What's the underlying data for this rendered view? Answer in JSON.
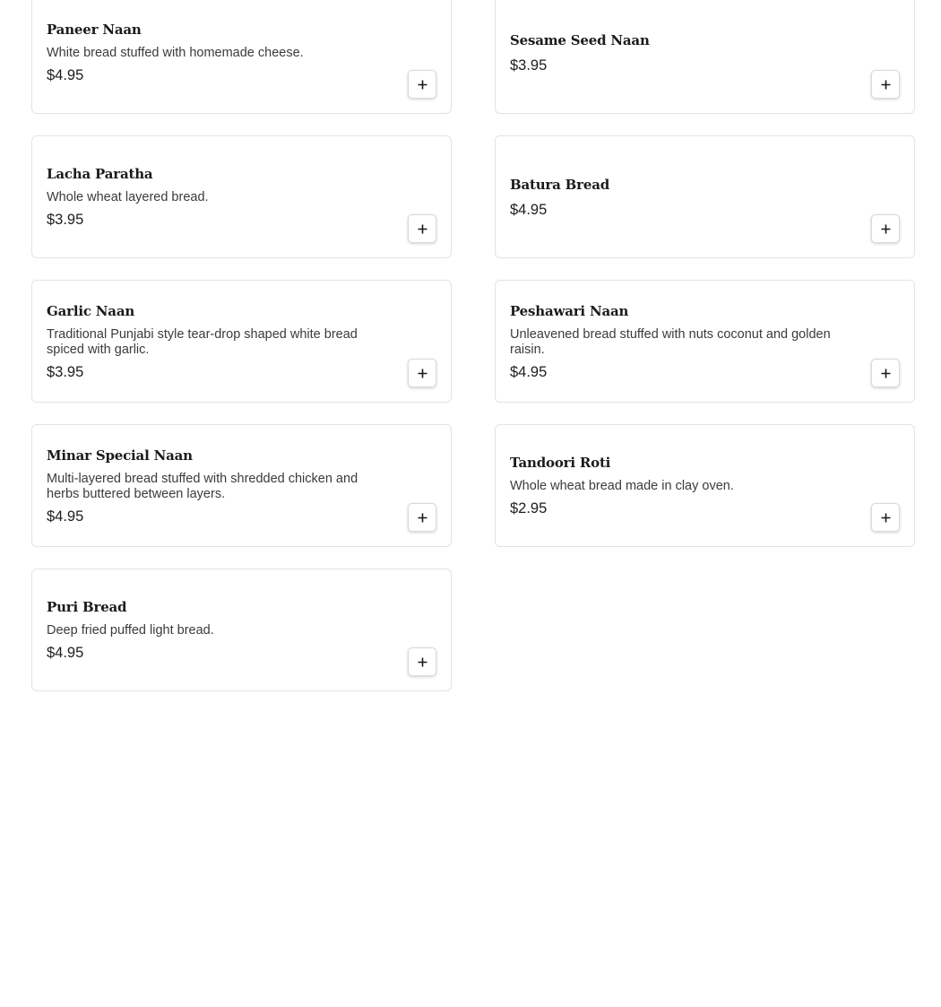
{
  "menu": {
    "items": [
      {
        "name": "Paneer Naan",
        "description": "White bread stuffed with homemade cheese.",
        "price": "$4.95"
      },
      {
        "name": "Sesame Seed Naan",
        "description": "",
        "price": "$3.95"
      },
      {
        "name": "Lacha Paratha",
        "description": "Whole wheat layered bread.",
        "price": "$3.95"
      },
      {
        "name": "Batura Bread",
        "description": "",
        "price": "$4.95"
      },
      {
        "name": "Garlic Naan",
        "description": "Traditional Punjabi style tear-drop shaped white bread spiced with garlic.",
        "price": "$3.95"
      },
      {
        "name": "Peshawari Naan",
        "description": "Unleavened bread stuffed with nuts coconut and golden raisin.",
        "price": "$4.95"
      },
      {
        "name": "Minar Special Naan",
        "description": "Multi-layered bread stuffed with shredded chicken and herbs buttered between layers.",
        "price": "$4.95"
      },
      {
        "name": "Tandoori Roti",
        "description": "Whole wheat bread made in clay oven.",
        "price": "$2.95"
      },
      {
        "name": "Puri Bread",
        "description": "Deep fried puffed light bread.",
        "price": "$4.95"
      }
    ],
    "add_icon": "plus-icon"
  }
}
